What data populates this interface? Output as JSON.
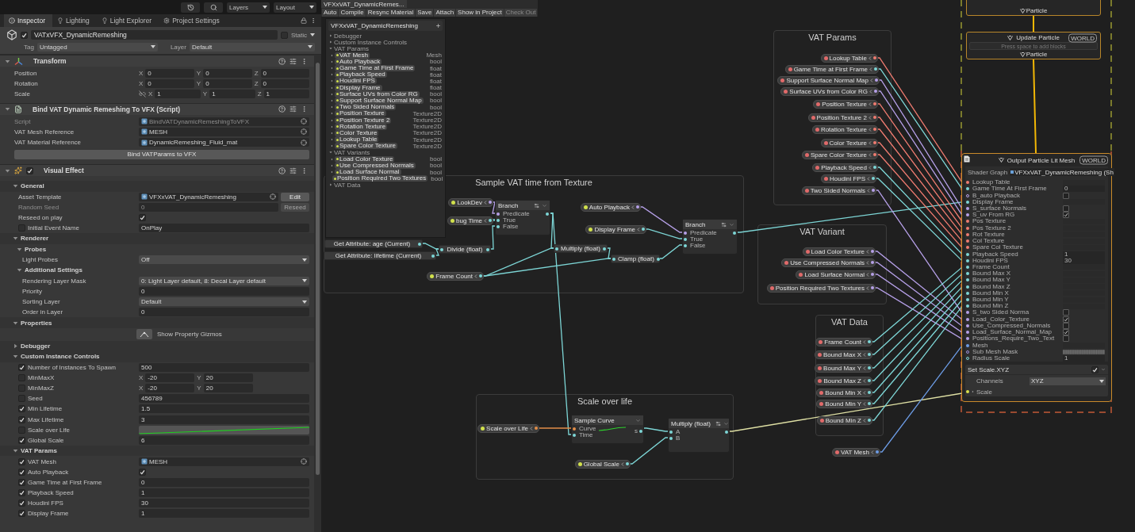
{
  "inspector": {
    "toolbar": {
      "layers": "Layers",
      "layout": "Layout"
    },
    "tabs": [
      {
        "label": "Inspector",
        "selected": true
      },
      {
        "label": "Lighting",
        "selected": false
      },
      {
        "label": "Light Explorer",
        "selected": false
      },
      {
        "label": "Project Settings",
        "selected": false
      }
    ],
    "object": {
      "active": true,
      "name": "VATxVFX_DynamicRemeshing",
      "static": false,
      "static_label": "Static",
      "tag_label": "Tag",
      "tag": "Untagged",
      "layer_label": "Layer",
      "layer": "Default"
    },
    "components": [
      {
        "title": "Transform",
        "expanded": true,
        "rows": [
          {
            "kind": "vec3",
            "label": "Position",
            "values": [
              {
                "axis": "X",
                "value": "0"
              },
              {
                "axis": "Y",
                "value": "0"
              },
              {
                "axis": "Z",
                "value": "0"
              }
            ]
          },
          {
            "kind": "vec3",
            "label": "Rotation",
            "values": [
              {
                "axis": "X",
                "value": "0"
              },
              {
                "axis": "Y",
                "value": "0"
              },
              {
                "axis": "Z",
                "value": "0"
              }
            ]
          },
          {
            "kind": "vec3",
            "label": "Scale",
            "proportional": false,
            "values": [
              {
                "axis": "X",
                "value": "1"
              },
              {
                "axis": "Y",
                "value": "1"
              },
              {
                "axis": "Z",
                "value": "1"
              }
            ]
          }
        ]
      },
      {
        "title": "Bind VAT Dynamic Remeshing To VFX (Script)",
        "expanded": true,
        "rows": [
          {
            "kind": "object",
            "label": "Script",
            "value": "BindVATDynamicRemeshingToVFX",
            "disabled": true
          },
          {
            "kind": "object",
            "label": "VAT Mesh Reference",
            "value": "MESH"
          },
          {
            "kind": "object",
            "label": "VAT Material Reference",
            "value": "DynamicRemeshing_Fluid_mat"
          },
          {
            "kind": "button",
            "label": "Bind VATParams to VFX"
          }
        ]
      },
      {
        "title": "Visual Effect",
        "enabled": true,
        "expanded": true,
        "rows": [
          {
            "kind": "foldout",
            "label": "General",
            "expanded": true,
            "children": [
              {
                "kind": "object",
                "label": "Asset Template",
                "value": "VFXxVAT_DynamicRemeshing",
                "button": {
                  "label": "Edit",
                  "disabled": false
                }
              },
              {
                "kind": "field",
                "label": "Random Seed",
                "value": "0",
                "disabled": true,
                "button": {
                  "label": "Reseed",
                  "disabled": true
                }
              },
              {
                "kind": "toggle",
                "label": "Reseed on play",
                "checked": true
              },
              {
                "kind": "field",
                "label": "Initial Event Name",
                "value": "OnPlay",
                "override": false
              }
            ]
          },
          {
            "kind": "foldout",
            "label": "Renderer",
            "expanded": true,
            "children": [
              {
                "kind": "foldout",
                "label": "Probes",
                "expanded": true,
                "children": [
                  {
                    "kind": "dropdown",
                    "label": "Light Probes",
                    "value": "Off"
                  }
                ]
              },
              {
                "kind": "foldout",
                "label": "Additional Settings",
                "expanded": true,
                "children": [
                  {
                    "kind": "dropdown",
                    "label": "Rendering Layer Mask",
                    "value": "0: Light Layer default, 8: Decal Layer default"
                  },
                  {
                    "kind": "field",
                    "label": "Priority",
                    "value": "0"
                  },
                  {
                    "kind": "dropdown",
                    "label": "Sorting Layer",
                    "value": "Default"
                  },
                  {
                    "kind": "field",
                    "label": "Order in Layer",
                    "value": "0"
                  }
                ]
              }
            ]
          },
          {
            "kind": "foldout",
            "label": "Properties",
            "expanded": true,
            "children": [
              {
                "kind": "gizmo",
                "label": "Show Property Gizmos"
              }
            ]
          },
          {
            "kind": "foldout",
            "label": "Debugger",
            "expanded": false
          },
          {
            "kind": "foldout",
            "label": "Custom Instance Controls",
            "expanded": true,
            "children": [
              {
                "kind": "field",
                "label": "Number of Instances To Spawn",
                "value": "500",
                "override": true
              },
              {
                "kind": "vec2",
                "label": "MinMaxX",
                "override": false,
                "values": [
                  {
                    "axis": "X",
                    "value": "-20"
                  },
                  {
                    "axis": "Y",
                    "value": "20"
                  }
                ]
              },
              {
                "kind": "vec2",
                "label": "MinMaxZ",
                "override": false,
                "values": [
                  {
                    "axis": "X",
                    "value": "-20"
                  },
                  {
                    "axis": "Y",
                    "value": "20"
                  }
                ]
              },
              {
                "kind": "field",
                "label": "Seed",
                "value": "456789",
                "override": false
              },
              {
                "kind": "field",
                "label": "Min Lifetime",
                "value": "1.5",
                "override": true
              },
              {
                "kind": "field",
                "label": "Max Lifetime",
                "value": "3",
                "override": true
              },
              {
                "kind": "curve",
                "label": "Scale over Life",
                "override": false
              },
              {
                "kind": "field",
                "label": "Global Scale",
                "value": "6",
                "override": true
              }
            ]
          },
          {
            "kind": "foldout",
            "label": "VAT Params",
            "expanded": true,
            "children": [
              {
                "kind": "object",
                "label": "VAT Mesh",
                "value": "MESH",
                "override": true
              },
              {
                "kind": "toggle",
                "label": "Auto Playback",
                "checked": true,
                "override": true
              },
              {
                "kind": "field",
                "label": "Game Time at First Frame",
                "value": "0",
                "override": true
              },
              {
                "kind": "field",
                "label": "Playback Speed",
                "value": "1",
                "override": true
              },
              {
                "kind": "field",
                "label": "Houdini FPS",
                "value": "30",
                "override": true
              },
              {
                "kind": "field",
                "label": "Display Frame",
                "value": "1",
                "override": true
              }
            ]
          }
        ]
      }
    ]
  },
  "graph": {
    "window": {
      "title": "VFXxVAT_DynamicRemes...",
      "buttons": [
        {
          "label": "Auto",
          "disabled": false
        },
        {
          "label": "Compile",
          "disabled": false
        },
        {
          "label": "Resync Material",
          "disabled": false
        },
        {
          "label": "Save",
          "disabled": false
        },
        {
          "label": "Attach",
          "disabled": false
        },
        {
          "label": "Show in Project",
          "disabled": false
        },
        {
          "label": "Check Out",
          "disabled": true
        }
      ]
    },
    "blackboard": {
      "title": "VFXxVAT_DynamicRemeshing",
      "categories": [
        {
          "name": "Debugger",
          "expanded": false
        },
        {
          "name": "Custom Instance Controls",
          "expanded": false
        },
        {
          "name": "VAT Params",
          "expanded": true,
          "items": [
            {
              "name": "VAT Mesh",
              "type": "Mesh"
            },
            {
              "name": "Auto Playback",
              "type": "bool"
            },
            {
              "name": "Game Time at First Frame",
              "type": "float"
            },
            {
              "name": "Playback Speed",
              "type": "float"
            },
            {
              "name": "Houdini FPS",
              "type": "float"
            },
            {
              "name": "Display Frame",
              "type": "float"
            },
            {
              "name": "Surface UVs from Color RG",
              "type": "bool"
            },
            {
              "name": "Support Surface Normal Map",
              "type": "bool"
            },
            {
              "name": "Two Sided Normals",
              "type": "bool"
            },
            {
              "name": "Position Texture",
              "type": "Texture2D"
            },
            {
              "name": "Position Texture 2",
              "type": "Texture2D"
            },
            {
              "name": "Rotation Texture",
              "type": "Texture2D"
            },
            {
              "name": "Color Texture",
              "type": "Texture2D"
            },
            {
              "name": "Lookup Table",
              "type": "Texture2D"
            },
            {
              "name": "Spare Color Texture",
              "type": "Texture2D"
            }
          ]
        },
        {
          "name": "VAT Variants",
          "expanded": true,
          "items": [
            {
              "name": "Load Color Texture",
              "type": "bool"
            },
            {
              "name": "Use Compressed Normals",
              "type": "bool"
            },
            {
              "name": "Load Surface Normal",
              "type": "bool"
            },
            {
              "name": "Position Required Two Textures",
              "type": "bool"
            }
          ]
        },
        {
          "name": "VAT Data",
          "expanded": false
        }
      ]
    },
    "groups": [
      {
        "title": "Sample VAT time from Texture"
      },
      {
        "title": "Scale over life"
      },
      {
        "title": "VAT Params"
      },
      {
        "title": "VAT Variant"
      },
      {
        "title": "VAT Data"
      }
    ],
    "property_nodes": [
      {
        "label": "LookDev",
        "kind": "bool",
        "color": "#d0e04c"
      },
      {
        "label": "bug Time",
        "kind": "float",
        "color": "#d0e04c"
      },
      {
        "label": "Auto Playback",
        "kind": "bool",
        "color": "#d0e04c"
      },
      {
        "label": "Display Frame",
        "kind": "float",
        "color": "#d0e04c"
      },
      {
        "label": "Frame Count",
        "kind": "float",
        "color": "#d0e04c"
      },
      {
        "label": "Scale over Life",
        "kind": "curve",
        "color": "#d0e04c"
      },
      {
        "label": "Global Scale",
        "kind": "float",
        "color": "#d0e04c"
      },
      {
        "label": "Lookup Table",
        "kind": "texture",
        "color": "#e06a6a"
      },
      {
        "label": "Game Time at First Frame",
        "kind": "float",
        "color": "#e06a6a"
      },
      {
        "label": "Support Surface Normal Map",
        "kind": "bool",
        "color": "#e06a6a"
      },
      {
        "label": "Surface UVs from Color RG",
        "kind": "bool",
        "color": "#e06a6a"
      },
      {
        "label": "Position Texture",
        "kind": "texture",
        "color": "#e06a6a"
      },
      {
        "label": "Position Texture 2",
        "kind": "texture",
        "color": "#e06a6a"
      },
      {
        "label": "Rotation Texture",
        "kind": "texture",
        "color": "#e06a6a"
      },
      {
        "label": "Color Texture",
        "kind": "texture",
        "color": "#e06a6a"
      },
      {
        "label": "Spare Color Texture",
        "kind": "texture",
        "color": "#e06a6a"
      },
      {
        "label": "Playback Speed",
        "kind": "float",
        "color": "#e06a6a"
      },
      {
        "label": "Houdini FPS",
        "kind": "float",
        "color": "#e06a6a"
      },
      {
        "label": "Two Sided Normals",
        "kind": "bool",
        "color": "#e06a6a"
      },
      {
        "label": "Load Color Texture",
        "kind": "bool",
        "color": "#e06a6a"
      },
      {
        "label": "Use Compressed Normals",
        "kind": "bool",
        "color": "#e06a6a"
      },
      {
        "label": "Load Surface Normal",
        "kind": "bool",
        "color": "#e06a6a"
      },
      {
        "label": "Position Required Two Textures",
        "kind": "bool",
        "color": "#e06a6a"
      },
      {
        "label": "Frame Count",
        "kind": "float",
        "color": "#e06a6a"
      },
      {
        "label": "Bound Max X",
        "kind": "float",
        "color": "#e06a6a"
      },
      {
        "label": "Bound Max Y",
        "kind": "float",
        "color": "#e06a6a"
      },
      {
        "label": "Bound Max Z",
        "kind": "float",
        "color": "#e06a6a"
      },
      {
        "label": "Bound Min X",
        "kind": "float",
        "color": "#e06a6a"
      },
      {
        "label": "Bound Min Y",
        "kind": "float",
        "color": "#e06a6a"
      },
      {
        "label": "Bound Min Z",
        "kind": "float",
        "color": "#e06a6a"
      },
      {
        "label": "VAT Mesh",
        "kind": "mesh",
        "color": "#e06a6a"
      }
    ],
    "operators": [
      {
        "kind": "attribute",
        "title": "Get Attribute: age (Current)"
      },
      {
        "kind": "attribute",
        "title": "Get Attribute: lifetime (Current)"
      },
      {
        "kind": "operator",
        "title": "Divide (float)"
      },
      {
        "kind": "block",
        "title": "Branch",
        "inputs": [
          {
            "label": "Predicate",
            "kind": "bool"
          },
          {
            "label": "True",
            "kind": "float"
          },
          {
            "label": "False",
            "kind": "float"
          }
        ]
      },
      {
        "kind": "operator",
        "title": "Multiply (float)"
      },
      {
        "kind": "operator",
        "title": "Clamp (float)"
      },
      {
        "kind": "block",
        "title": "Branch",
        "inputs": [
          {
            "label": "Predicate",
            "kind": "bool"
          },
          {
            "label": "True",
            "kind": "float"
          },
          {
            "label": "False",
            "kind": "float"
          }
        ]
      },
      {
        "kind": "block",
        "title": "Sample Curve",
        "output": "s",
        "inputs": [
          {
            "label": "Curve",
            "kind": "curve"
          },
          {
            "label": "Time",
            "kind": "float"
          }
        ]
      },
      {
        "kind": "block",
        "title": "Multiply (float)",
        "inputs": [
          {
            "label": "A",
            "kind": "float"
          },
          {
            "label": "B",
            "kind": "float"
          }
        ]
      }
    ],
    "contexts": [
      {
        "kind": "stub",
        "footer": "Particle"
      },
      {
        "kind": "update",
        "title": "Update Particle",
        "space": "WORLD",
        "placeholder": "Press space to add blocks",
        "footer": "Particle"
      }
    ],
    "output": {
      "title": "Output Particle Lit Mesh",
      "space": "WORLD",
      "shader_label": "Shader Graph",
      "shader_value": "VFXxVAT_DynamicRemeshing (Sh",
      "inputs": [
        {
          "label": "Lookup Table",
          "kind": "texture"
        },
        {
          "label": "Game Time At First Frame",
          "kind": "float",
          "value": "0"
        },
        {
          "label": "B_auto Playback",
          "kind": "bool",
          "checked": false
        },
        {
          "label": "Display Frame",
          "kind": "float"
        },
        {
          "label": "S_surface Normals",
          "kind": "bool",
          "checked": false
        },
        {
          "label": "S_uv From RG",
          "kind": "bool",
          "checked": true
        },
        {
          "label": "Pos Texture",
          "kind": "texture"
        },
        {
          "label": "Pos Texture 2",
          "kind": "texture"
        },
        {
          "label": "Rot Texture",
          "kind": "texture"
        },
        {
          "label": "Col Texture",
          "kind": "texture"
        },
        {
          "label": "Spare Col Texture",
          "kind": "texture"
        },
        {
          "label": "Playback Speed",
          "kind": "float",
          "value": "1"
        },
        {
          "label": "Houdini FPS",
          "kind": "float",
          "value": "30"
        },
        {
          "label": "Frame Count",
          "kind": "float"
        },
        {
          "label": "Bound Max X",
          "kind": "float"
        },
        {
          "label": "Bound Max Y",
          "kind": "float"
        },
        {
          "label": "Bound Max Z",
          "kind": "float"
        },
        {
          "label": "Bound Min X",
          "kind": "float"
        },
        {
          "label": "Bound Min Y",
          "kind": "float"
        },
        {
          "label": "Bound Min Z",
          "kind": "float"
        },
        {
          "label": "S_two Sided Norma",
          "kind": "bool",
          "checked": false
        },
        {
          "label": "Load_Color_Texture",
          "kind": "bool",
          "checked": true
        },
        {
          "label": "Use_Compressed_Normals",
          "kind": "bool",
          "checked": false
        },
        {
          "label": "Load_Surface_Normal_Map",
          "kind": "bool",
          "checked": true
        },
        {
          "label": "Positions_Require_Two_Text",
          "kind": "bool",
          "checked": false
        },
        {
          "label": "Mesh",
          "kind": "mesh"
        },
        {
          "label": "Sub Mesh Mask",
          "kind": "mask"
        },
        {
          "label": "Radius Scale",
          "kind": "float",
          "value": "1"
        }
      ],
      "block": {
        "title": "Set Scale.XYZ",
        "enabled": true,
        "channels_label": "Channels",
        "channels": "XYZ",
        "input": "Scale"
      }
    }
  }
}
